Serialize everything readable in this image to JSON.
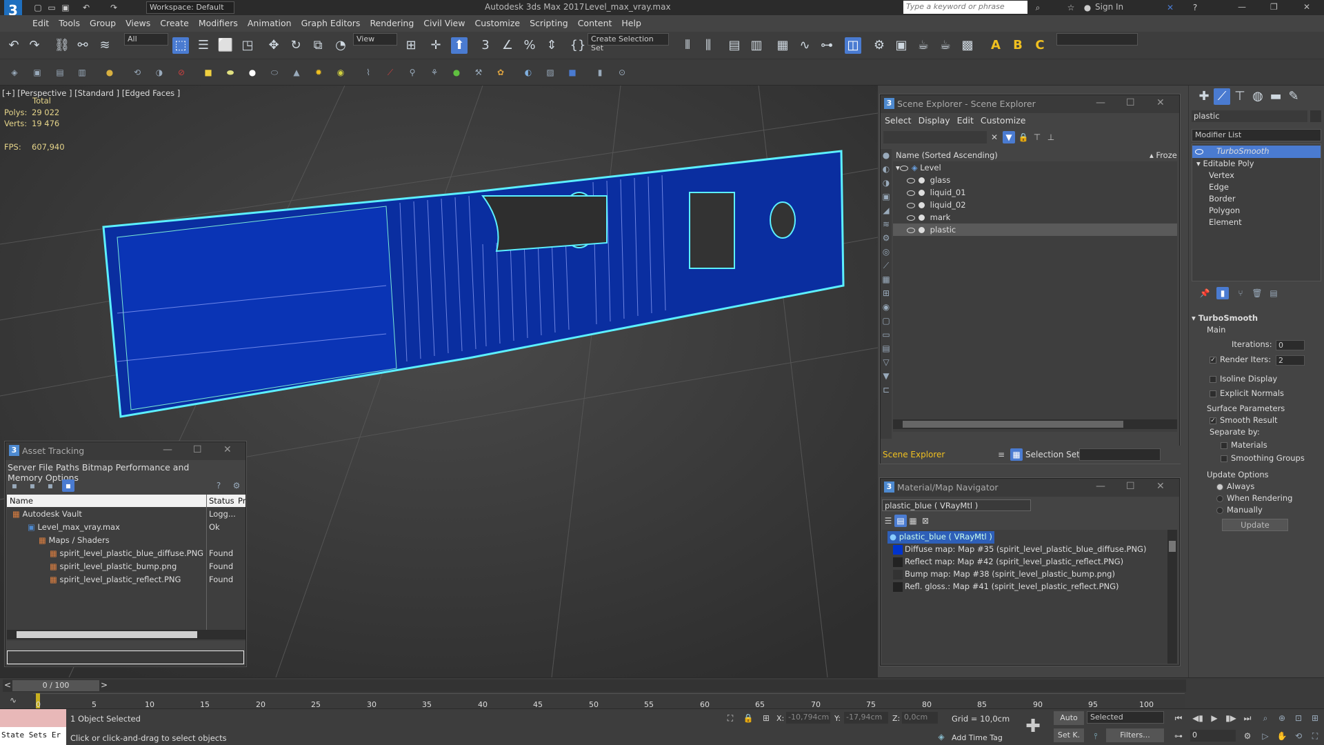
{
  "title_bar": {
    "workspace": "Workspace: Default",
    "app_title": "Autodesk 3ds Max 2017",
    "file": "Level_max_vray.max",
    "search_placeholder": "Type a keyword or phrase",
    "sign_in": "Sign In"
  },
  "menu": [
    "Edit",
    "Tools",
    "Group",
    "Views",
    "Create",
    "Modifiers",
    "Animation",
    "Graph Editors",
    "Rendering",
    "Civil View",
    "Customize",
    "Scripting",
    "Content",
    "Help"
  ],
  "toolbar": {
    "filter_value": "All",
    "ref_coord": "View",
    "named_selection": "Create Selection Set"
  },
  "viewport": {
    "label": "[+] [Perspective ] [Standard ] [Edged Faces ]",
    "total_label": "Total",
    "polys_label": "Polys:",
    "polys_value": "29 022",
    "verts_label": "Verts:",
    "verts_value": "19 476",
    "fps_label": "FPS:",
    "fps_value": "607,940"
  },
  "scene_explorer": {
    "title": "Scene Explorer - Scene Explorer",
    "menu": [
      "Select",
      "Display",
      "Edit",
      "Customize"
    ],
    "column_name": "Name (Sorted Ascending)",
    "column_frozen": "▴ Froze",
    "items": [
      {
        "label": "Level"
      },
      {
        "label": "glass"
      },
      {
        "label": "liquid_01"
      },
      {
        "label": "liquid_02"
      },
      {
        "label": "mark"
      },
      {
        "label": "plastic"
      }
    ],
    "footer_label": "Scene Explorer",
    "selection_set_label": "Selection Set:"
  },
  "asset_tracking": {
    "title": "Asset Tracking",
    "menu": [
      "Server",
      "File",
      "Paths",
      "Bitmap Performance and Memory",
      "Options"
    ],
    "col_name": "Name",
    "col_status": "Status",
    "col_extra": "Pr",
    "rows": [
      {
        "name": "Autodesk Vault",
        "status": "Logg..."
      },
      {
        "name": "Level_max_vray.max",
        "status": "Ok"
      },
      {
        "name": "Maps / Shaders",
        "status": ""
      },
      {
        "name": "spirit_level_plastic_blue_diffuse.PNG",
        "status": "Found"
      },
      {
        "name": "spirit_level_plastic_bump.png",
        "status": "Found"
      },
      {
        "name": "spirit_level_plastic_reflect.PNG",
        "status": "Found"
      }
    ]
  },
  "material_nav": {
    "title": "Material/Map Navigator",
    "current": "plastic_blue  ( VRayMtl )",
    "root": "plastic_blue  ( VRayMtl )",
    "maps": [
      "Diffuse map: Map #35 (spirit_level_plastic_blue_diffuse.PNG)",
      "Reflect map: Map #42 (spirit_level_plastic_reflect.PNG)",
      "Bump map: Map #38 (spirit_level_plastic_bump.png)",
      "Refl. gloss.: Map #41 (spirit_level_plastic_reflect.PNG)"
    ]
  },
  "command_panel": {
    "object_name": "plastic",
    "modifier_list": "Modifier List",
    "stack": {
      "turbosmooth": "TurboSmooth",
      "editable_poly": "Editable Poly",
      "subobjects": [
        "Vertex",
        "Edge",
        "Border",
        "Polygon",
        "Element"
      ]
    },
    "rollout_title": "TurboSmooth",
    "main_label": "Main",
    "iterations_label": "Iterations:",
    "iterations_value": "0",
    "render_iters_label": "Render Iters:",
    "render_iters_value": "2",
    "isoline": "Isoline Display",
    "explicit_normals": "Explicit Normals",
    "surface_params": "Surface Parameters",
    "smooth_result": "Smooth Result",
    "separate_by": "Separate by:",
    "materials": "Materials",
    "smoothing_groups": "Smoothing Groups",
    "update_options": "Update Options",
    "always": "Always",
    "when_rendering": "When Rendering",
    "manually": "Manually",
    "update_button": "Update"
  },
  "timeline": {
    "frame": "0 / 100",
    "ticks": [
      "0",
      "5",
      "10",
      "15",
      "20",
      "25",
      "30",
      "35",
      "40",
      "45",
      "50",
      "55",
      "60",
      "65",
      "70",
      "75",
      "80",
      "85",
      "90",
      "95",
      "100"
    ]
  },
  "status_bar": {
    "maxscript": "State Sets Er",
    "selected": "1 Object Selected",
    "prompt": "Click or click-and-drag to select objects",
    "x_label": "X:",
    "x_value": "-10,794cm",
    "y_label": "Y:",
    "y_value": "-17,94cm",
    "z_label": "Z:",
    "z_value": "0,0cm",
    "grid": "Grid = 10,0cm",
    "add_time_tag": "Add Time Tag",
    "auto": "Auto",
    "set_key": "Set K.",
    "key_mode": "Selected",
    "filters": "Filters...",
    "frame_value": "0"
  },
  "colors": {
    "accent": "#4a7bd1",
    "mesh_blue": "#0a2ea0",
    "wire_cyan": "#5cf0ff",
    "selected_row": "#2e5fb8"
  }
}
